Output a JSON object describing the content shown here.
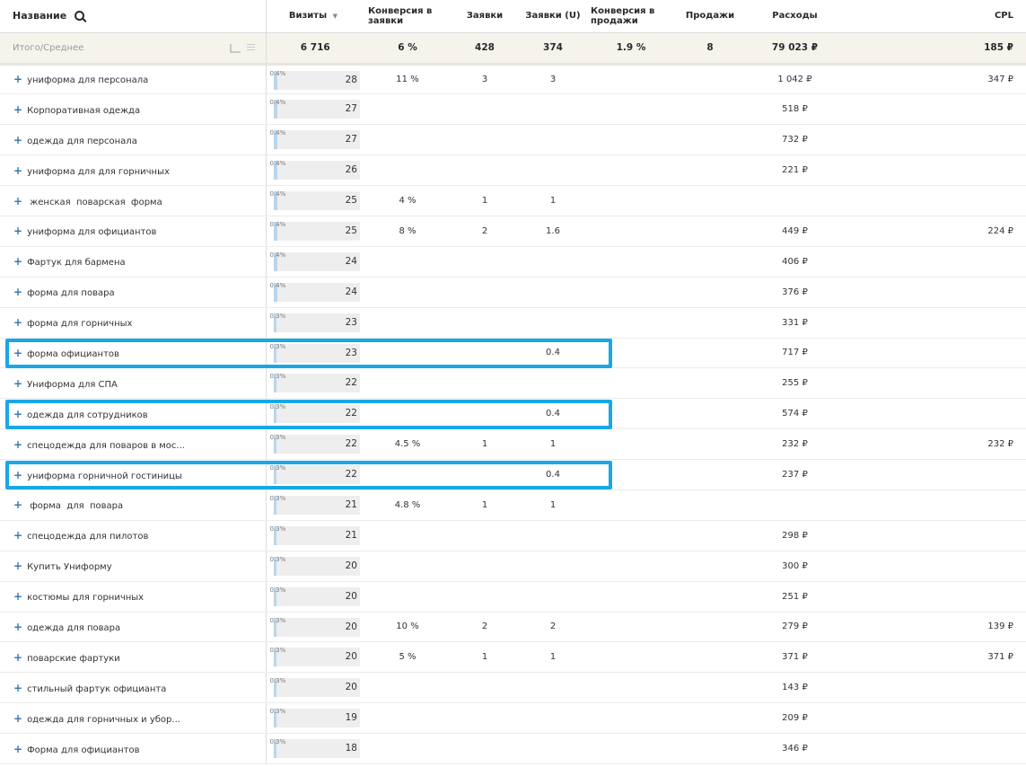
{
  "colors": {
    "accent": "#1aa7e6",
    "bar_fill": "#b9d6ec",
    "totals_bg": "#f5f3ec",
    "expand": "#3a79b0"
  },
  "columns": {
    "name": "Название",
    "visits": "Визиты",
    "conversion_requests": "Конверсия в заявки",
    "requests": "Заявки",
    "requests_unique": "Заявки (U)",
    "conversion_sales": "Конверсия в продажи",
    "sales": "Продажи",
    "costs": "Расходы",
    "cpl": "CPL"
  },
  "icons": {
    "search": "search-icon",
    "sort": "sort-desc-icon",
    "expand": "plus-icon",
    "chart": "chart-icon",
    "list": "list-icon"
  },
  "totals": {
    "label": "Итого/Среднее",
    "visits": "6 716",
    "conversion_requests": "6 %",
    "requests": "428",
    "requests_unique": "374",
    "conversion_sales": "1.9 %",
    "sales": "8",
    "costs": "79 023 ₽",
    "cpl": "185 ₽"
  },
  "rows": [
    {
      "name": "униформа для персонала",
      "share": "0.4%",
      "share_fraction": 0.004,
      "visits": "28",
      "conversion_requests": "11 %",
      "requests": "3",
      "requests_unique": "3",
      "conversion_sales": "",
      "sales": "",
      "costs": "1 042 ₽",
      "cpl": "347 ₽",
      "highlighted": false
    },
    {
      "name": "Корпоративная одежда",
      "share": "0.4%",
      "share_fraction": 0.004,
      "visits": "27",
      "conversion_requests": "",
      "requests": "",
      "requests_unique": "",
      "conversion_sales": "",
      "sales": "",
      "costs": "518 ₽",
      "cpl": "",
      "highlighted": false
    },
    {
      "name": "одежда для персонала",
      "share": "0.4%",
      "share_fraction": 0.004,
      "visits": "27",
      "conversion_requests": "",
      "requests": "",
      "requests_unique": "",
      "conversion_sales": "",
      "sales": "",
      "costs": "732 ₽",
      "cpl": "",
      "highlighted": false
    },
    {
      "name": "униформа для для горничных",
      "share": "0.4%",
      "share_fraction": 0.004,
      "visits": "26",
      "conversion_requests": "",
      "requests": "",
      "requests_unique": "",
      "conversion_sales": "",
      "sales": "",
      "costs": "221 ₽",
      "cpl": "",
      "highlighted": false
    },
    {
      "name": " женская  поварская  форма",
      "share": "0.4%",
      "share_fraction": 0.004,
      "visits": "25",
      "conversion_requests": "4 %",
      "requests": "1",
      "requests_unique": "1",
      "conversion_sales": "",
      "sales": "",
      "costs": "",
      "cpl": "",
      "highlighted": false
    },
    {
      "name": "униформа для официантов",
      "share": "0.4%",
      "share_fraction": 0.004,
      "visits": "25",
      "conversion_requests": "8 %",
      "requests": "2",
      "requests_unique": "1.6",
      "conversion_sales": "",
      "sales": "",
      "costs": "449 ₽",
      "cpl": "224 ₽",
      "highlighted": false
    },
    {
      "name": "Фартук для бармена",
      "share": "0.4%",
      "share_fraction": 0.004,
      "visits": "24",
      "conversion_requests": "",
      "requests": "",
      "requests_unique": "",
      "conversion_sales": "",
      "sales": "",
      "costs": "406 ₽",
      "cpl": "",
      "highlighted": false
    },
    {
      "name": "форма для повара",
      "share": "0.4%",
      "share_fraction": 0.004,
      "visits": "24",
      "conversion_requests": "",
      "requests": "",
      "requests_unique": "",
      "conversion_sales": "",
      "sales": "",
      "costs": "376 ₽",
      "cpl": "",
      "highlighted": false
    },
    {
      "name": "форма для горничных",
      "share": "0.3%",
      "share_fraction": 0.003,
      "visits": "23",
      "conversion_requests": "",
      "requests": "",
      "requests_unique": "",
      "conversion_sales": "",
      "sales": "",
      "costs": "331 ₽",
      "cpl": "",
      "highlighted": false
    },
    {
      "name": "форма официантов",
      "share": "0.3%",
      "share_fraction": 0.003,
      "visits": "23",
      "conversion_requests": "",
      "requests": "",
      "requests_unique": "0.4",
      "conversion_sales": "",
      "sales": "",
      "costs": "717 ₽",
      "cpl": "",
      "highlighted": true
    },
    {
      "name": "Униформа для СПА",
      "share": "0.3%",
      "share_fraction": 0.003,
      "visits": "22",
      "conversion_requests": "",
      "requests": "",
      "requests_unique": "",
      "conversion_sales": "",
      "sales": "",
      "costs": "255 ₽",
      "cpl": "",
      "highlighted": false
    },
    {
      "name": "одежда для сотрудников",
      "share": "0.3%",
      "share_fraction": 0.003,
      "visits": "22",
      "conversion_requests": "",
      "requests": "",
      "requests_unique": "0.4",
      "conversion_sales": "",
      "sales": "",
      "costs": "574 ₽",
      "cpl": "",
      "highlighted": true
    },
    {
      "name": "спецодежда для поваров в мос...",
      "share": "0.3%",
      "share_fraction": 0.003,
      "visits": "22",
      "conversion_requests": "4.5 %",
      "requests": "1",
      "requests_unique": "1",
      "conversion_sales": "",
      "sales": "",
      "costs": "232 ₽",
      "cpl": "232 ₽",
      "highlighted": false
    },
    {
      "name": "униформа горничной гостиницы",
      "share": "0.3%",
      "share_fraction": 0.003,
      "visits": "22",
      "conversion_requests": "",
      "requests": "",
      "requests_unique": "0.4",
      "conversion_sales": "",
      "sales": "",
      "costs": "237 ₽",
      "cpl": "",
      "highlighted": true
    },
    {
      "name": " форма  для  повара",
      "share": "0.3%",
      "share_fraction": 0.003,
      "visits": "21",
      "conversion_requests": "4.8 %",
      "requests": "1",
      "requests_unique": "1",
      "conversion_sales": "",
      "sales": "",
      "costs": "",
      "cpl": "",
      "highlighted": false
    },
    {
      "name": "спецодежда для пилотов",
      "share": "0.3%",
      "share_fraction": 0.003,
      "visits": "21",
      "conversion_requests": "",
      "requests": "",
      "requests_unique": "",
      "conversion_sales": "",
      "sales": "",
      "costs": "298 ₽",
      "cpl": "",
      "highlighted": false
    },
    {
      "name": "Купить Униформу",
      "share": "0.3%",
      "share_fraction": 0.003,
      "visits": "20",
      "conversion_requests": "",
      "requests": "",
      "requests_unique": "",
      "conversion_sales": "",
      "sales": "",
      "costs": "300 ₽",
      "cpl": "",
      "highlighted": false
    },
    {
      "name": "костюмы для горничных",
      "share": "0.3%",
      "share_fraction": 0.003,
      "visits": "20",
      "conversion_requests": "",
      "requests": "",
      "requests_unique": "",
      "conversion_sales": "",
      "sales": "",
      "costs": "251 ₽",
      "cpl": "",
      "highlighted": false
    },
    {
      "name": "одежда для повара",
      "share": "0.3%",
      "share_fraction": 0.003,
      "visits": "20",
      "conversion_requests": "10 %",
      "requests": "2",
      "requests_unique": "2",
      "conversion_sales": "",
      "sales": "",
      "costs": "279 ₽",
      "cpl": "139 ₽",
      "highlighted": false
    },
    {
      "name": "поварские фартуки",
      "share": "0.3%",
      "share_fraction": 0.003,
      "visits": "20",
      "conversion_requests": "5 %",
      "requests": "1",
      "requests_unique": "1",
      "conversion_sales": "",
      "sales": "",
      "costs": "371 ₽",
      "cpl": "371 ₽",
      "highlighted": false
    },
    {
      "name": "стильный фартук официанта",
      "share": "0.3%",
      "share_fraction": 0.003,
      "visits": "20",
      "conversion_requests": "",
      "requests": "",
      "requests_unique": "",
      "conversion_sales": "",
      "sales": "",
      "costs": "143 ₽",
      "cpl": "",
      "highlighted": false
    },
    {
      "name": "одежда для горничных и убор...",
      "share": "0.3%",
      "share_fraction": 0.003,
      "visits": "19",
      "conversion_requests": "",
      "requests": "",
      "requests_unique": "",
      "conversion_sales": "",
      "sales": "",
      "costs": "209 ₽",
      "cpl": "",
      "highlighted": false
    },
    {
      "name": "Форма для официантов",
      "share": "0.3%",
      "share_fraction": 0.003,
      "visits": "18",
      "conversion_requests": "",
      "requests": "",
      "requests_unique": "",
      "conversion_sales": "",
      "sales": "",
      "costs": "346 ₽",
      "cpl": "",
      "highlighted": false
    }
  ]
}
